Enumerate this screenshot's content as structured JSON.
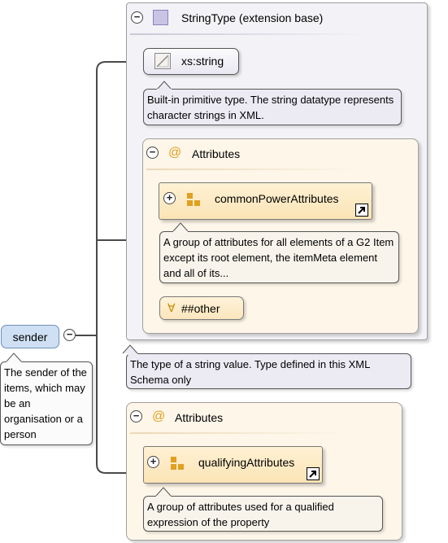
{
  "sender": {
    "label": "sender",
    "description": "The sender of the items, which may be an organisation or a person"
  },
  "string_type": {
    "title": "StringType (extension base)",
    "base_label": "xs:string",
    "base_note": "Built-in primitive type. The string datatype represents character strings in XML.",
    "note": "The type of a string value. Type defined in this XML Schema only",
    "attributes": {
      "title": "Attributes",
      "group_label": "commonPowerAttributes",
      "group_note": "A group of attributes for all elements of a G2 Item except its root element, the itemMeta element and all of its...",
      "any_label": "##other"
    }
  },
  "own_attributes": {
    "title": "Attributes",
    "group_label": "qualifyingAttributes",
    "group_note": "A group of attributes used for a qualified expression of the property"
  },
  "symbols": {
    "collapse": "−",
    "expand": "+",
    "at": "@",
    "forall": "∀"
  },
  "colors": {
    "type_panel_bg": "#f3f3f7",
    "attr_panel_bg": "#fdf6e9",
    "sender_bg": "#cfe0f5",
    "attribute_icon": "#e0a020"
  }
}
